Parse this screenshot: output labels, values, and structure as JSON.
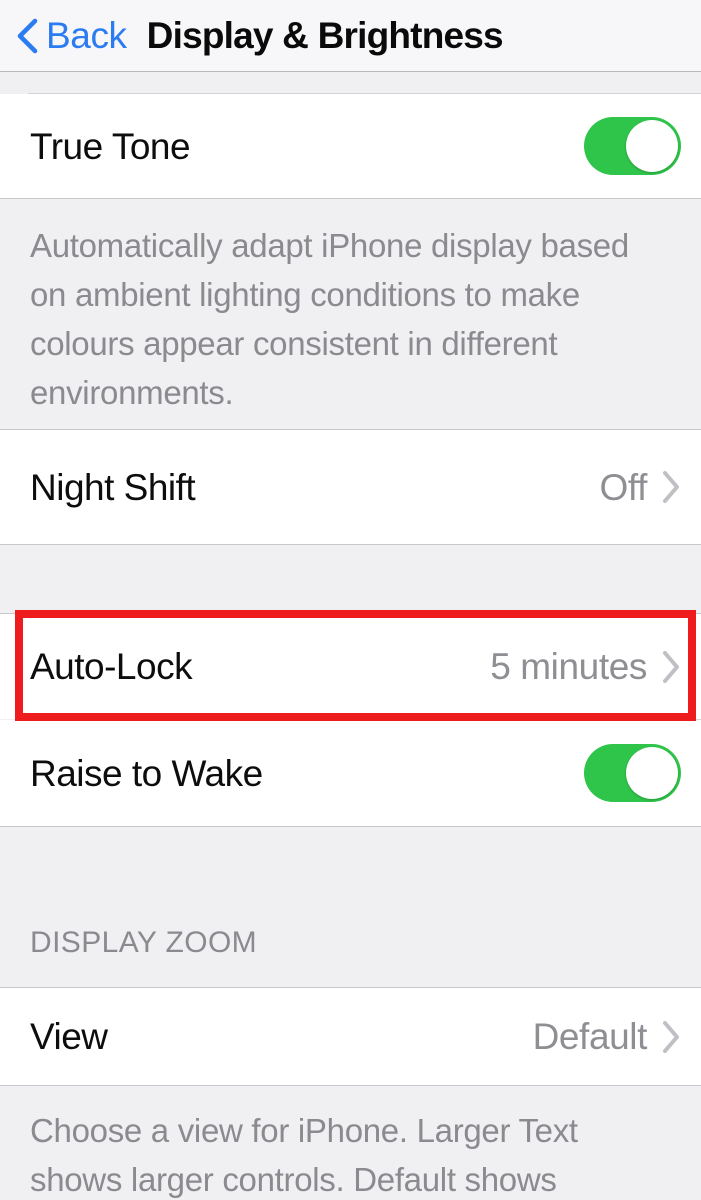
{
  "navbar": {
    "back_label": "Back",
    "back_icon": "chevron-left-icon",
    "title": "Display & Brightness",
    "accent_color": "#2b7cf0"
  },
  "sections": [
    {
      "id": "true-tone",
      "rows": [
        {
          "id": "true-tone",
          "title": "True Tone",
          "control": "toggle",
          "toggle_on": true,
          "toggle_color": "#2fc44a"
        }
      ],
      "footer": "Automatically adapt iPhone display based on ambient lighting conditions to make colours appear consistent in different environments."
    },
    {
      "id": "night-shift",
      "rows": [
        {
          "id": "night-shift",
          "title": "Night Shift",
          "value": "Off",
          "control": "disclosure",
          "chevron_icon": "chevron-right-icon"
        }
      ]
    },
    {
      "id": "auto-lock",
      "rows": [
        {
          "id": "auto-lock",
          "title": "Auto-Lock",
          "value": "5 minutes",
          "control": "disclosure",
          "chevron_icon": "chevron-right-icon",
          "highlighted": true
        },
        {
          "id": "raise-to-wake",
          "title": "Raise to Wake",
          "control": "toggle",
          "toggle_on": true,
          "toggle_color": "#2fc44a"
        }
      ]
    },
    {
      "id": "display-zoom",
      "header": "DISPLAY ZOOM",
      "rows": [
        {
          "id": "view",
          "title": "View",
          "value": "Default",
          "control": "disclosure",
          "chevron_icon": "chevron-right-icon"
        }
      ],
      "footer": "Choose a view for iPhone. Larger Text shows larger controls. Default shows"
    }
  ],
  "annotation": {
    "type": "rectangle-highlight",
    "color": "#ee1c1c",
    "target": "auto-lock-row"
  }
}
